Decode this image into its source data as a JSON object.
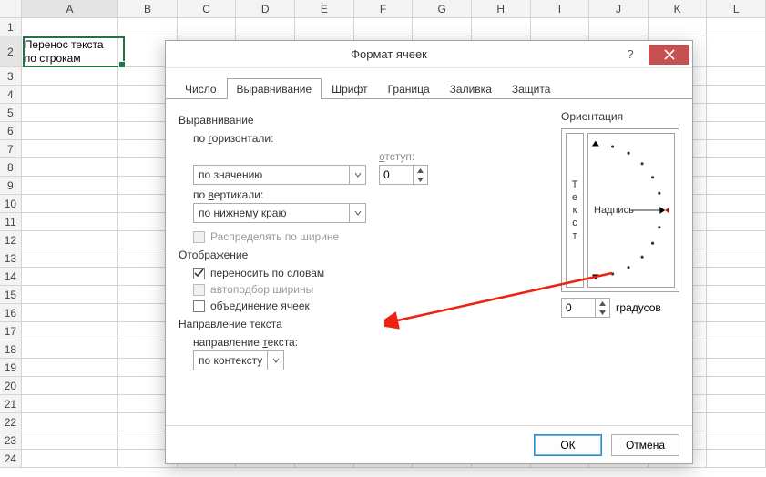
{
  "columns": [
    "A",
    "B",
    "C",
    "D",
    "E",
    "F",
    "G",
    "H",
    "I",
    "J",
    "K",
    "L"
  ],
  "rows_before": [
    "1"
  ],
  "row_tall": "2",
  "rows_after": [
    "3",
    "4",
    "5",
    "6",
    "7",
    "8",
    "9",
    "10",
    "11",
    "12",
    "13",
    "14",
    "15",
    "16",
    "17",
    "18",
    "19",
    "20",
    "21",
    "22",
    "23",
    "24"
  ],
  "cell_A2": "Перенос текста по строкам",
  "dialog": {
    "title": "Формат ячеек",
    "tabs": [
      "Число",
      "Выравнивание",
      "Шрифт",
      "Граница",
      "Заливка",
      "Защита"
    ],
    "group_alignment": "Выравнивание",
    "lbl_horizontal": "по горизонтали:",
    "val_horizontal": "по значению",
    "lbl_indent": "отступ:",
    "val_indent": "0",
    "lbl_vertical": "по вертикали:",
    "val_vertical": "по нижнему краю",
    "chk_distribute": "Распределять по ширине",
    "group_display": "Отображение",
    "chk_wrap": "переносить по словам",
    "chk_shrink": "автоподбор ширины",
    "chk_merge": "объединение ячеек",
    "group_direction": "Направление текста",
    "lbl_textdir": "направление текста:",
    "val_textdir": "по контексту",
    "group_orientation": "Ориентация",
    "vtext": [
      "Т",
      "е",
      "к",
      "с",
      "т"
    ],
    "dial_label": "Надпись",
    "val_degrees": "0",
    "lbl_degrees": "градусов",
    "btn_ok": "ОК",
    "btn_cancel": "Отмена"
  }
}
